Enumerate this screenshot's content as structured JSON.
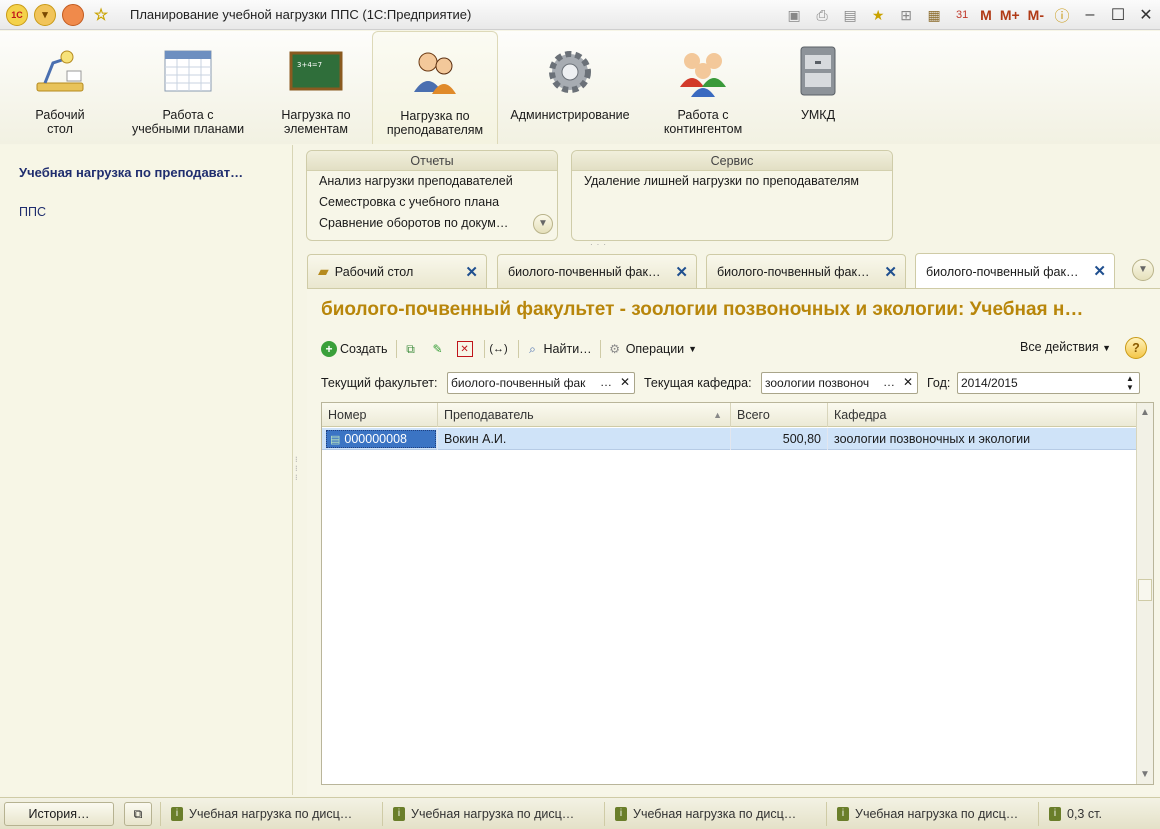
{
  "window": {
    "title": "Планирование учебной нагрузки ППС  (1С:Предприятие)",
    "right_labels": [
      "M",
      "M+",
      "M-"
    ]
  },
  "sections": [
    {
      "label": "Рабочий\nстол",
      "icon": "desk-lamp-icon"
    },
    {
      "label": "Работа с\nучебными планами",
      "icon": "calendar-icon"
    },
    {
      "label": "Нагрузка по\nэлементам",
      "icon": "blackboard-icon"
    },
    {
      "label": "Нагрузка по\nпреподавателям",
      "icon": "teachers-icon"
    },
    {
      "label": "Администрирование",
      "icon": "gear-icon"
    },
    {
      "label": "Работа с\nконтингентом",
      "icon": "people-icon"
    },
    {
      "label": "УМКД",
      "icon": "file-cabinet-icon"
    }
  ],
  "left_panel": {
    "title": "Учебная нагрузка по преподават…",
    "items": [
      "ППС"
    ]
  },
  "reports": {
    "header": "Отчеты",
    "items": [
      "Анализ нагрузки преподавателей",
      "Семестровка с учебного плана",
      "Сравнение оборотов по докум…"
    ]
  },
  "service": {
    "header": "Сервис",
    "items": [
      "Удаление лишней нагрузки по преподавателям"
    ]
  },
  "tabs": [
    {
      "label": "Рабочий стол"
    },
    {
      "label": "биолого-почвенный фак…"
    },
    {
      "label": "биолого-почвенный фак…"
    },
    {
      "label": "биолого-почвенный фак…"
    }
  ],
  "form": {
    "title": "биолого-почвенный факультет - зоологии позвоночных и экологии: Учебная н…",
    "toolbar": {
      "create": "Создать",
      "find": "Найти…",
      "operations": "Операции",
      "all_actions": "Все действия",
      "help": "?"
    },
    "filters": {
      "faculty_label": "Текущий факультет:",
      "faculty_value": "биолого-почвенный фак",
      "dept_label": "Текущая кафедра:",
      "dept_value": "зоологии позвоноч",
      "year_label": "Год:",
      "year_value": "2014/2015"
    },
    "table": {
      "columns": [
        "Номер",
        "Преподаватель",
        "Всего",
        "Кафедра"
      ],
      "rows": [
        {
          "number": "000000008",
          "teacher": "Вокин А.И.",
          "total": "500,80",
          "department": "зоологии позвоночных и экологии"
        }
      ]
    }
  },
  "taskbar": {
    "history": "История…",
    "items": [
      "Учебная нагрузка по дисц…",
      "Учебная нагрузка по дисц…",
      "Учебная нагрузка по дисц…",
      "Учебная нагрузка по дисц…"
    ],
    "status": "0,3 ст."
  },
  "colors": {
    "accent_title": "#b8860b",
    "selection": "#cfe3f8",
    "nav_text": "#1f2d6e"
  }
}
